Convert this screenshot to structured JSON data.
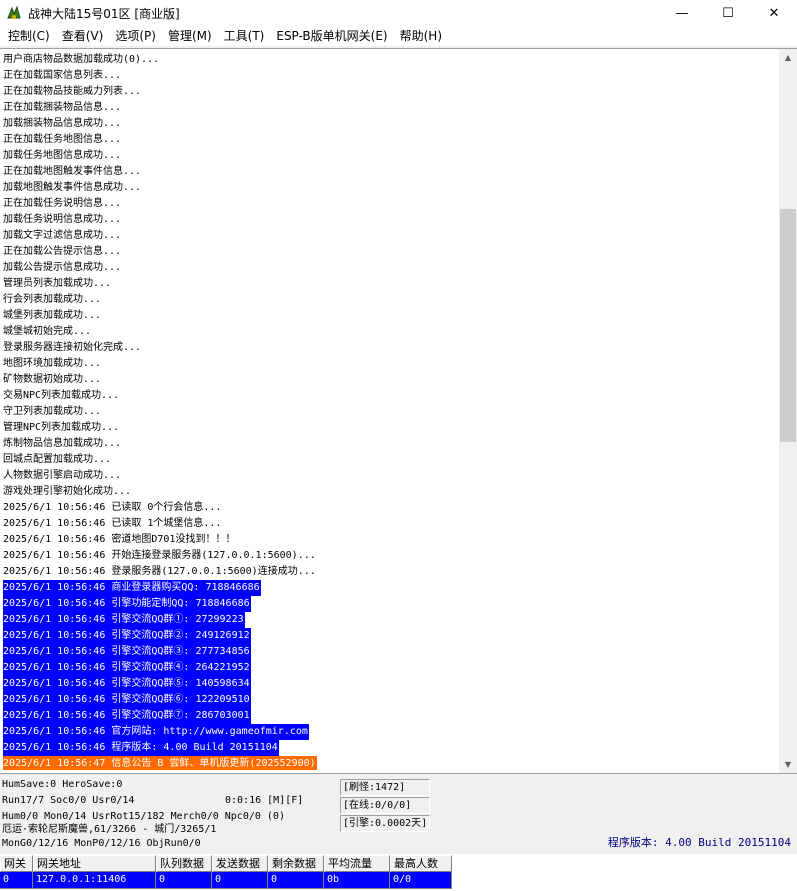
{
  "window": {
    "title": "战神大陆15号01区 [商业版]",
    "controls": {
      "minimize": "—",
      "maximize": "☐",
      "close": "✕"
    },
    "icon": "game-app-icon"
  },
  "menu": [
    "控制(C)",
    "查看(V)",
    "选项(P)",
    "管理(M)",
    "工具(T)",
    "ESP-B版单机网关(E)",
    "帮助(H)"
  ],
  "log": {
    "lines": [
      "用户商店物品数据加载成功(0)...",
      "正在加载国家信息列表...",
      "正在加载物品技能威力列表...",
      "正在加载捆装物品信息...",
      "加载捆装物品信息成功...",
      "正在加载任务地图信息...",
      "加载任务地图信息成功...",
      "正在加载地图触发事件信息...",
      "加载地图触发事件信息成功...",
      "正在加载任务说明信息...",
      "加载任务说明信息成功...",
      "加载文字过滤信息成功...",
      "正在加载公告提示信息...",
      "加载公告提示信息成功...",
      "管理员列表加载成功...",
      "行会列表加载成功...",
      "城堡列表加载成功...",
      "城堡城初始完成...",
      "登录服务器连接初始化完成...",
      "地图环境加载成功...",
      "矿物数据初始成功...",
      "交易NPC列表加载成功...",
      "守卫列表加载成功...",
      "管理NPC列表加载成功...",
      "炼制物品信息加载成功...",
      "回城点配置加载成功...",
      "人物数据引擎启动成功...",
      "游戏处理引擎初始化成功...",
      "2025/6/1 10:56:46 已读取 0个行会信息...",
      "2025/6/1 10:56:46 已读取 1个城堡信息...",
      "2025/6/1 10:56:46 密道地图D701没找到！！！",
      "2025/6/1 10:56:46 开始连接登录服务器(127.0.0.1:5600)...",
      "2025/6/1 10:56:46 登录服务器(127.0.0.1:5600)连接成功...",
      "2025/6/1 10:56:46 商业登录器购买QQ: 718846686",
      "2025/6/1 10:56:46 引擎功能定制QQ: 718846686",
      "2025/6/1 10:56:46 引擎交流QQ群①: 27299223",
      "2025/6/1 10:56:46 引擎交流QQ群②: 249126912",
      "2025/6/1 10:56:46 引擎交流QQ群③: 277734856",
      "2025/6/1 10:56:46 引擎交流QQ群④: 264221952",
      "2025/6/1 10:56:46 引擎交流QQ群⑤: 140598634",
      "2025/6/1 10:56:46 引擎交流QQ群⑥: 122209510",
      "2025/6/1 10:56:46 引擎交流QQ群⑦: 286703001",
      "2025/6/1 10:56:46 官方网站: http://www.gameofmir.com",
      "2025/6/1 10:56:46 程序版本: 4.00 Build 20151104",
      "2025/6/1 10:56:47 信息公告 B 尝鲜、单机版更新(202552900)"
    ],
    "highlight_blue_from": 33,
    "highlight_blue_to": 43,
    "highlight_orange": 44,
    "colors": {
      "blue": "#0000ff",
      "orange": "#ff6a00"
    }
  },
  "status": {
    "humsave": "HumSave:0 HeroSave:0",
    "run": "Run17/7 Soc0/0 Usr0/14",
    "timer": "0:0:16 [M][F]",
    "counts": "Hum0/0 Mon0/14 UsrRot15/182 Merch0/0 Npc0/0 (0)",
    "location": "厄运·索轮尼斯魔兽,61/3266 - 城门/3265/1",
    "mon": "MonG0/12/16 MonP0/12/16 ObjRun0/0",
    "refresh": "[刷怪:1472]",
    "online": "[在线:0/0/0]",
    "engine": "[引擎:0.0002天]",
    "version": "程序版本: 4.00 Build 20151104"
  },
  "gateway_table": {
    "headers": [
      "网关",
      "网关地址",
      "队列数据",
      "发送数据",
      "剩余数据",
      "平均流量",
      "最高人数"
    ],
    "rows": [
      [
        "0",
        "127.0.0.1:11406",
        "0",
        "0",
        "0",
        "0b",
        "0/0"
      ]
    ]
  }
}
